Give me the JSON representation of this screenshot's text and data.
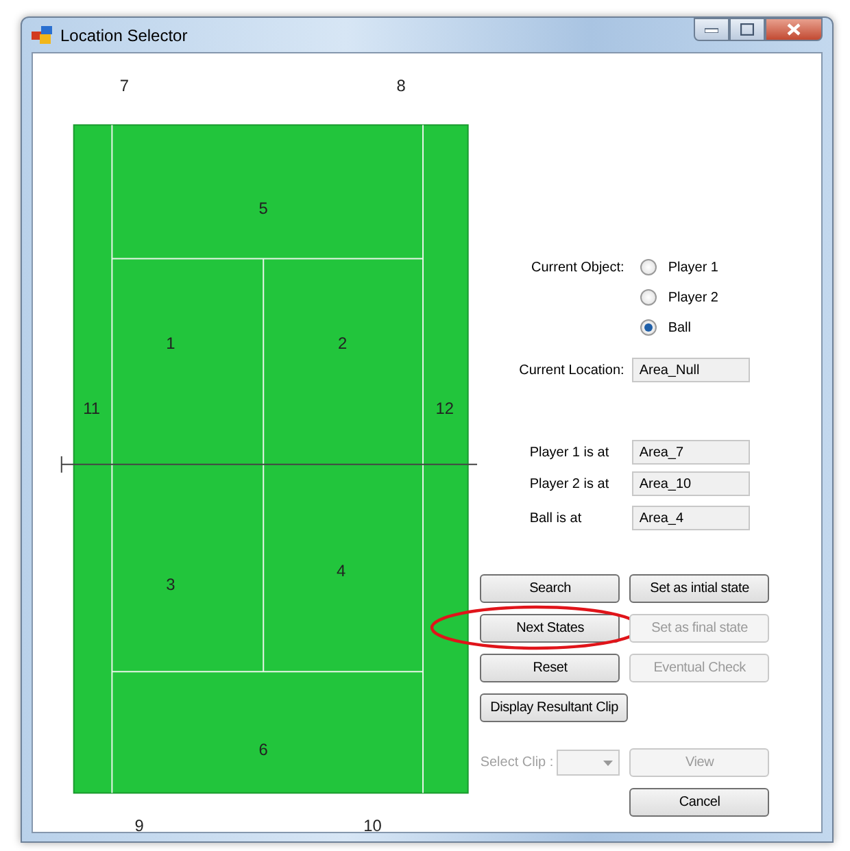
{
  "window": {
    "title": "Location Selector"
  },
  "court": {
    "area_labels": [
      "7",
      "8",
      "5",
      "1",
      "2",
      "11",
      "12",
      "3",
      "4",
      "6",
      "9",
      "10"
    ]
  },
  "current_object": {
    "label": "Current Object:",
    "options": [
      {
        "label": "Player 1",
        "selected": false
      },
      {
        "label": "Player 2",
        "selected": false
      },
      {
        "label": "Ball",
        "selected": true
      }
    ]
  },
  "current_location": {
    "label": "Current Location:",
    "value": "Area_Null"
  },
  "positions": [
    {
      "label": "Player 1 is at",
      "value": "Area_7"
    },
    {
      "label": "Player 2 is at",
      "value": "Area_10"
    },
    {
      "label": "Ball is at",
      "value": "Area_4"
    }
  ],
  "buttons": [
    {
      "label": "Search",
      "disabled": false,
      "highlighted": false
    },
    {
      "label": "Set as intial state",
      "disabled": false,
      "highlighted": false
    },
    {
      "label": "Next States",
      "disabled": false,
      "highlighted": true
    },
    {
      "label": "Set as final state",
      "disabled": true,
      "highlighted": false
    },
    {
      "label": "Reset",
      "disabled": false,
      "highlighted": false
    },
    {
      "label": "Eventual Check",
      "disabled": true,
      "highlighted": false
    },
    {
      "label": "Display Resultant Clip",
      "disabled": false,
      "highlighted": false
    }
  ],
  "select_clip": {
    "label": "Select Clip :",
    "disabled": true
  },
  "view_button": {
    "label": "View",
    "disabled": true
  },
  "cancel_button": {
    "label": "Cancel",
    "disabled": false
  }
}
